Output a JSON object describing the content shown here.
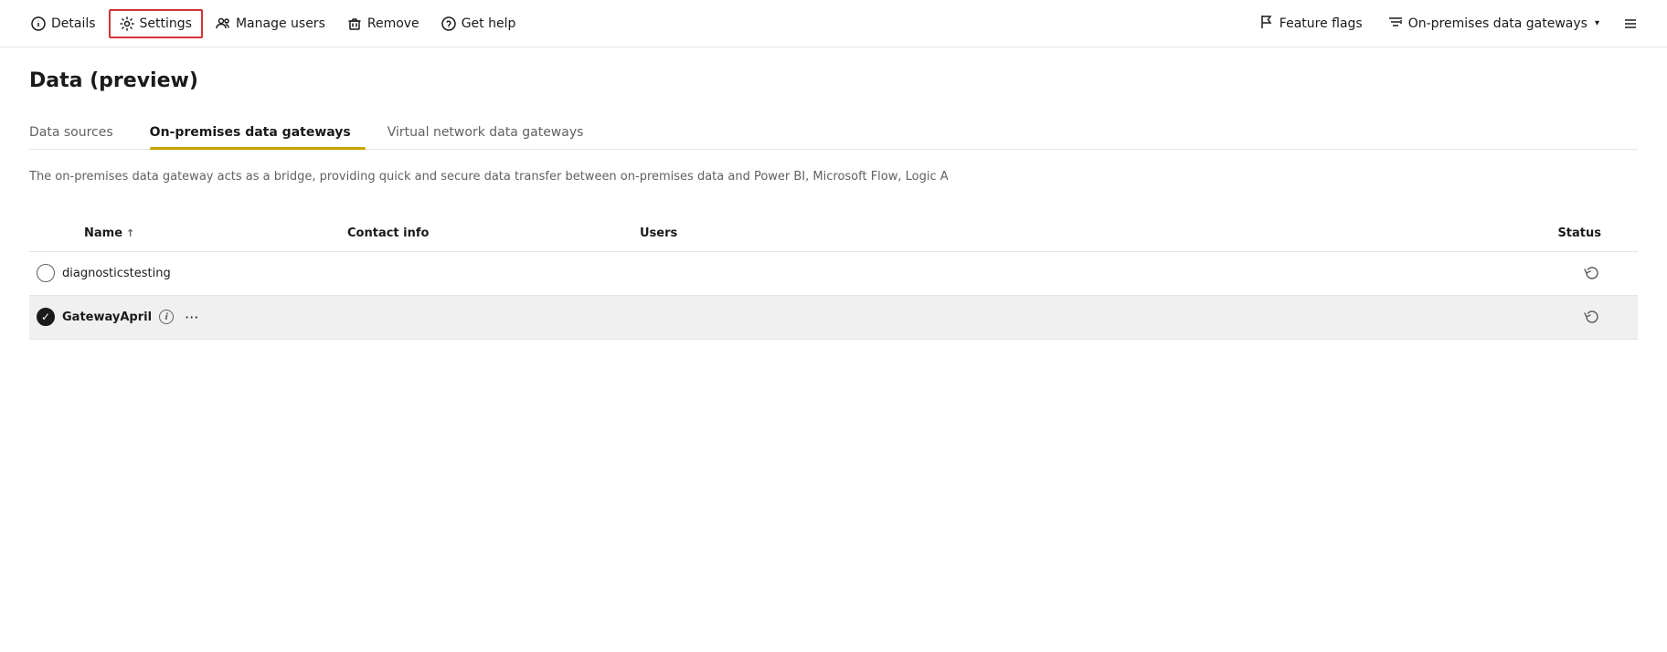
{
  "toolbar": {
    "items": [
      {
        "id": "details",
        "label": "Details",
        "icon": "info-circle"
      },
      {
        "id": "settings",
        "label": "Settings",
        "icon": "gear",
        "highlighted": true
      },
      {
        "id": "manage-users",
        "label": "Manage users",
        "icon": "people"
      },
      {
        "id": "remove",
        "label": "Remove",
        "icon": "trash"
      },
      {
        "id": "get-help",
        "label": "Get help",
        "icon": "question-circle"
      }
    ],
    "right_items": [
      {
        "id": "feature-flags",
        "label": "Feature flags",
        "icon": "flag"
      },
      {
        "id": "on-premises-gateways",
        "label": "On-premises data gateways",
        "icon": "filter"
      }
    ]
  },
  "page": {
    "title": "Data (preview)",
    "description": "The on-premises data gateway acts as a bridge, providing quick and secure data transfer between on-premises data and Power BI, Microsoft Flow, Logic A"
  },
  "tabs": [
    {
      "id": "data-sources",
      "label": "Data sources",
      "active": false
    },
    {
      "id": "on-premises",
      "label": "On-premises data gateways",
      "active": true
    },
    {
      "id": "virtual-network",
      "label": "Virtual network data gateways",
      "active": false
    }
  ],
  "table": {
    "columns": [
      {
        "id": "name",
        "label": "Name",
        "sortable": true,
        "sort_direction": "asc"
      },
      {
        "id": "contact-info",
        "label": "Contact info",
        "sortable": false
      },
      {
        "id": "users",
        "label": "Users",
        "sortable": false
      },
      {
        "id": "status",
        "label": "Status",
        "sortable": false
      }
    ],
    "rows": [
      {
        "id": "row-1",
        "checked": false,
        "name": "diagnosticstesting",
        "contact_info": "",
        "users": "",
        "status": "refresh-icon",
        "selected": false,
        "show_info": false,
        "show_ellipsis": false
      },
      {
        "id": "row-2",
        "checked": true,
        "name": "GatewayApril",
        "contact_info": "",
        "users": "",
        "status": "refresh-icon",
        "selected": true,
        "show_info": true,
        "show_ellipsis": true
      }
    ]
  }
}
